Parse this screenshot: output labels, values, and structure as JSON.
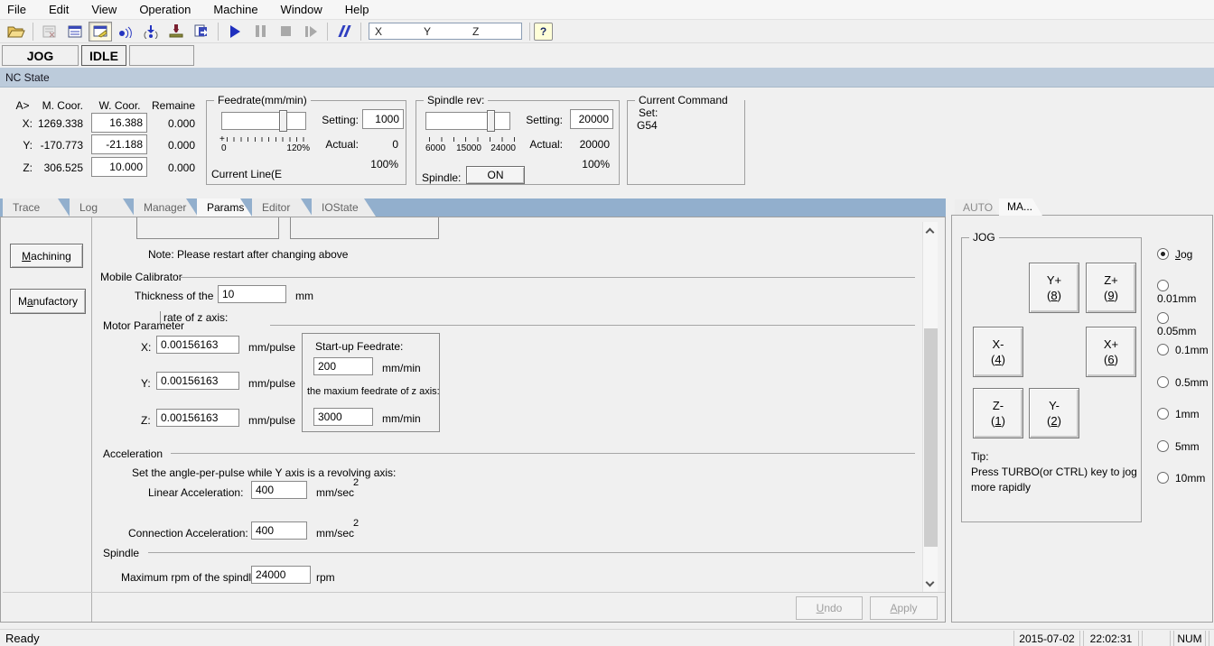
{
  "menu": {
    "items": [
      "File",
      "Edit",
      "View",
      "Operation",
      "Machine",
      "Window",
      "Help"
    ]
  },
  "toolbar": {
    "xyz_parts": [
      "X",
      "Y",
      "Z"
    ],
    "play_glyph": "",
    "help_glyph": "?"
  },
  "mode": {
    "jog": "JOG",
    "state": "IDLE"
  },
  "nc_state": {
    "title": "NC State"
  },
  "coords": {
    "headers": {
      "axis": "A>",
      "m": "M. Coor.",
      "w": "W. Coor.",
      "remain": "Remaine"
    },
    "rows": [
      {
        "axis": "X:",
        "m": "1269.338",
        "w": "16.388",
        "remain": "0.000"
      },
      {
        "axis": "Y:",
        "m": "-170.773",
        "w": "-21.188",
        "remain": "0.000"
      },
      {
        "axis": "Z:",
        "m": "306.525",
        "w": "10.000",
        "remain": "0.000"
      }
    ]
  },
  "feedrate": {
    "legend": "Feedrate(mm/min)",
    "origin": "+",
    "scale_min": "0",
    "scale_max": "120%",
    "setting_label": "Setting:",
    "setting_value": "1000",
    "actual_label": "Actual:",
    "actual_value": "0",
    "percent": "100%",
    "current_line": "Current Line(E"
  },
  "spindle_rev": {
    "legend": "Spindle rev:",
    "ticks": [
      "6000",
      "15000",
      "24000"
    ],
    "setting_label": "Setting:",
    "setting_value": "20000",
    "actual_label": "Actual:",
    "actual_value": "20000",
    "percent": "100%",
    "spindle_label": "Spindle:",
    "on_label": "ON"
  },
  "command_set": {
    "legend": "Current Command Set:",
    "value": "G54"
  },
  "main_tabs": {
    "items": [
      "Trace",
      "Log",
      "Manager",
      "Params",
      "Editor",
      "IOState"
    ],
    "active": "Params"
  },
  "params": {
    "machining": {
      "u": "M",
      "rest": "achining"
    },
    "manufactory": {
      "pre": "M",
      "u": "a",
      "rest": "nufactory"
    },
    "note": "Note: Please restart after changing above",
    "mobile_title": "Mobile Calibrator",
    "thickness_label": "Thickness of the",
    "thickness_value": "10",
    "thickness_unit": "mm",
    "motor_title": "Motor Parameter",
    "motor_artifact": "rate of z axis:",
    "motor_rows": [
      {
        "axis": "X:",
        "value": "0.00156163",
        "unit": "mm/pulse"
      },
      {
        "axis": "Y:",
        "value": "0.00156163",
        "unit": "mm/pulse"
      },
      {
        "axis": "Z:",
        "value": "0.00156163",
        "unit": "mm/pulse"
      }
    ],
    "startup": {
      "title": "Start-up Feedrate:",
      "value": "200",
      "unit": "mm/min",
      "z_label": "the maxium feedrate of z axis:",
      "z_value": "3000",
      "z_unit": "mm/min"
    },
    "accel_title": "Acceleration",
    "accel_note": "Set the angle-per-pulse while Y axis is a revolving axis:",
    "linear": {
      "label": "Linear Acceleration:",
      "value": "400",
      "unit": "mm/sec",
      "sup": "2"
    },
    "connection": {
      "label": "Connection Acceleration:",
      "value": "400",
      "unit": "mm/sec",
      "sup": "2"
    },
    "spindle_title": "Spindle",
    "rpm": {
      "label": "Maximum rpm of the spindle:",
      "value": "24000",
      "unit": "rpm"
    },
    "undo": {
      "u": "U",
      "rest": "ndo"
    },
    "apply": {
      "u": "A",
      "rest": "pply"
    }
  },
  "right_panel": {
    "tabs": {
      "auto": "AUTO",
      "manual": "MA..."
    },
    "jog_legend": "JOG",
    "paren_open": "(",
    "paren_close": ")",
    "buttons": [
      {
        "axis": "Y+",
        "key": "8"
      },
      {
        "axis": "Z+",
        "key": "9"
      },
      {
        "axis": "X-",
        "key": "4"
      },
      {
        "axis": "X+",
        "key": "6"
      },
      {
        "axis": "Z-",
        "key": "1"
      },
      {
        "axis": "Y-",
        "key": "2"
      }
    ],
    "tip": {
      "title": "Tip:",
      "line1": "Press TURBO(or CTRL) key to jog",
      "line2": "more rapidly"
    },
    "step_options": {
      "jog_u": "J",
      "jog_rest": "og",
      "others": [
        "0.01mm",
        "0.05mm",
        "0.1mm",
        "0.5mm",
        "1mm",
        "5mm",
        "10mm"
      ]
    }
  },
  "status_bar": {
    "ready": "Ready",
    "date": "2015-07-02",
    "time": "22:02:31",
    "num": "NUM"
  },
  "colors": {
    "tab_strip": "#92afcd",
    "nc_bar": "#bccbdb",
    "accent_blue": "#2434c0"
  }
}
